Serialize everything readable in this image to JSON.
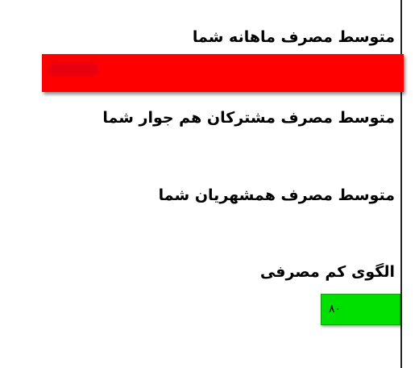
{
  "labels": {
    "monthly_avg": "متوسط مصرف ماهانه شما",
    "neighbors_avg": "متوسط مصرف مشترکان هم جوار شما",
    "citizens_avg": "متوسط مصرف همشهریان شما",
    "low_pattern": "الگوی کم مصرفی"
  },
  "values": {
    "monthly_avg": "",
    "low_pattern": "۸۰"
  },
  "colors": {
    "monthly_bar": "#ff0000",
    "pattern_bar": "#00e000"
  }
}
